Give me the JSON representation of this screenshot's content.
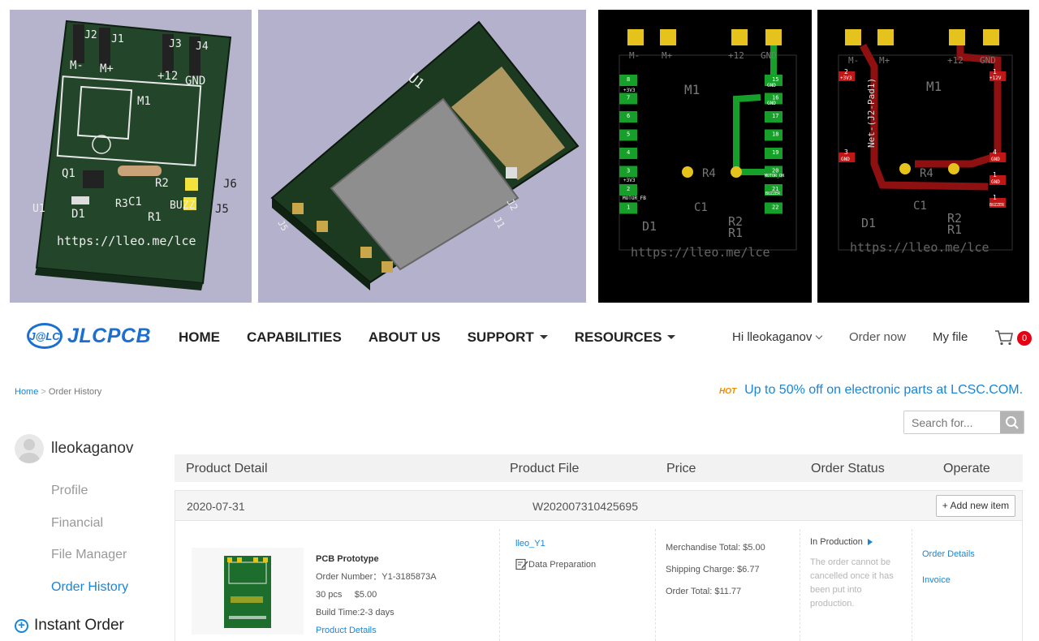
{
  "gallery": {
    "panel1": {
      "labels": [
        "J2",
        "J1",
        "J3",
        "J4",
        "M-",
        "M+",
        "+12",
        "GND",
        "M1",
        "Q1",
        "R2",
        "R3",
        "C1",
        "BUZZ",
        "D1",
        "R1",
        "U1",
        "J6",
        "J5"
      ],
      "url": "https://lleo.me/lce"
    },
    "panel2": {
      "labels": [
        "U1",
        "J2",
        "J1",
        "J5"
      ]
    },
    "panel3": {
      "labels": [
        "M-",
        "M+",
        "+12",
        "GND",
        "M1",
        "R4",
        "C1",
        "D1",
        "R2",
        "R1"
      ],
      "pins": [
        "8",
        "7",
        "6",
        "5",
        "4",
        "3",
        "2",
        "1",
        "15",
        "16",
        "17",
        "18",
        "19",
        "20",
        "21",
        "22"
      ],
      "pin_names": [
        "+3V3",
        "+3V3",
        "MOTOR_FB",
        "GND",
        "GND",
        "MOTOR_ON",
        "BUZZER"
      ],
      "url": "https://lleo.me/lce"
    },
    "panel4": {
      "labels": [
        "M-",
        "M+",
        "+12",
        "GND",
        "M1",
        "R4",
        "C1",
        "D1",
        "R2",
        "R1",
        "Net-(J2-Pad1)"
      ],
      "pins": [
        "2",
        "1",
        "3",
        "4",
        "1",
        "1"
      ],
      "pin_names": [
        "+3V3",
        "+12V",
        "GND",
        "GND",
        "GND",
        "BUZZER"
      ],
      "url": "https://lleo.me/lce"
    }
  },
  "nav": {
    "logo_mark": "J@LC",
    "logo_text": "JLCPCB",
    "items": [
      {
        "label": "HOME"
      },
      {
        "label": "CAPABILITIES"
      },
      {
        "label": "ABOUT US"
      },
      {
        "label": "SUPPORT"
      },
      {
        "label": "RESOURCES"
      }
    ],
    "greeting": "Hi lleokaganov",
    "order_now": "Order now",
    "my_file": "My file",
    "cart_count": "0"
  },
  "breadcrumb": {
    "home": "Home",
    "separator": ">",
    "current": "Order History"
  },
  "promo": {
    "badge": "HOT",
    "text": "Up to 50% off on electronic parts at LCSC.COM."
  },
  "search": {
    "placeholder": "Search for..."
  },
  "sidebar": {
    "username": "lleokaganov",
    "links": [
      {
        "label": "Profile"
      },
      {
        "label": "Financial"
      },
      {
        "label": "File Manager"
      },
      {
        "label": "Order History"
      }
    ],
    "instant_order": "Instant Order"
  },
  "table": {
    "headers": [
      "Product Detail",
      "Product File",
      "Price",
      "Order Status",
      "Operate"
    ]
  },
  "order": {
    "date": "2020-07-31",
    "batch": "W202007310425695",
    "add_item": "+ Add new item",
    "product_title": "PCB Prototype",
    "order_number_label": "Order Number：",
    "order_number": "Y1-3185873A",
    "qty": "30 pcs",
    "qty_price": "$5.00",
    "build_time": "Build Time:2-3 days",
    "product_details": "Product Details",
    "file_name": "lleo_Y1",
    "file_status": "Data Preparation",
    "merchandise": "Merchandise Total: $5.00",
    "shipping": "Shipping Charge: $6.77",
    "total": "Order Total: $11.77",
    "status": "In Production",
    "status_note": "The order cannot be cancelled once it has been put into production.",
    "op_details": "Order Details",
    "op_invoice": "Invoice"
  }
}
